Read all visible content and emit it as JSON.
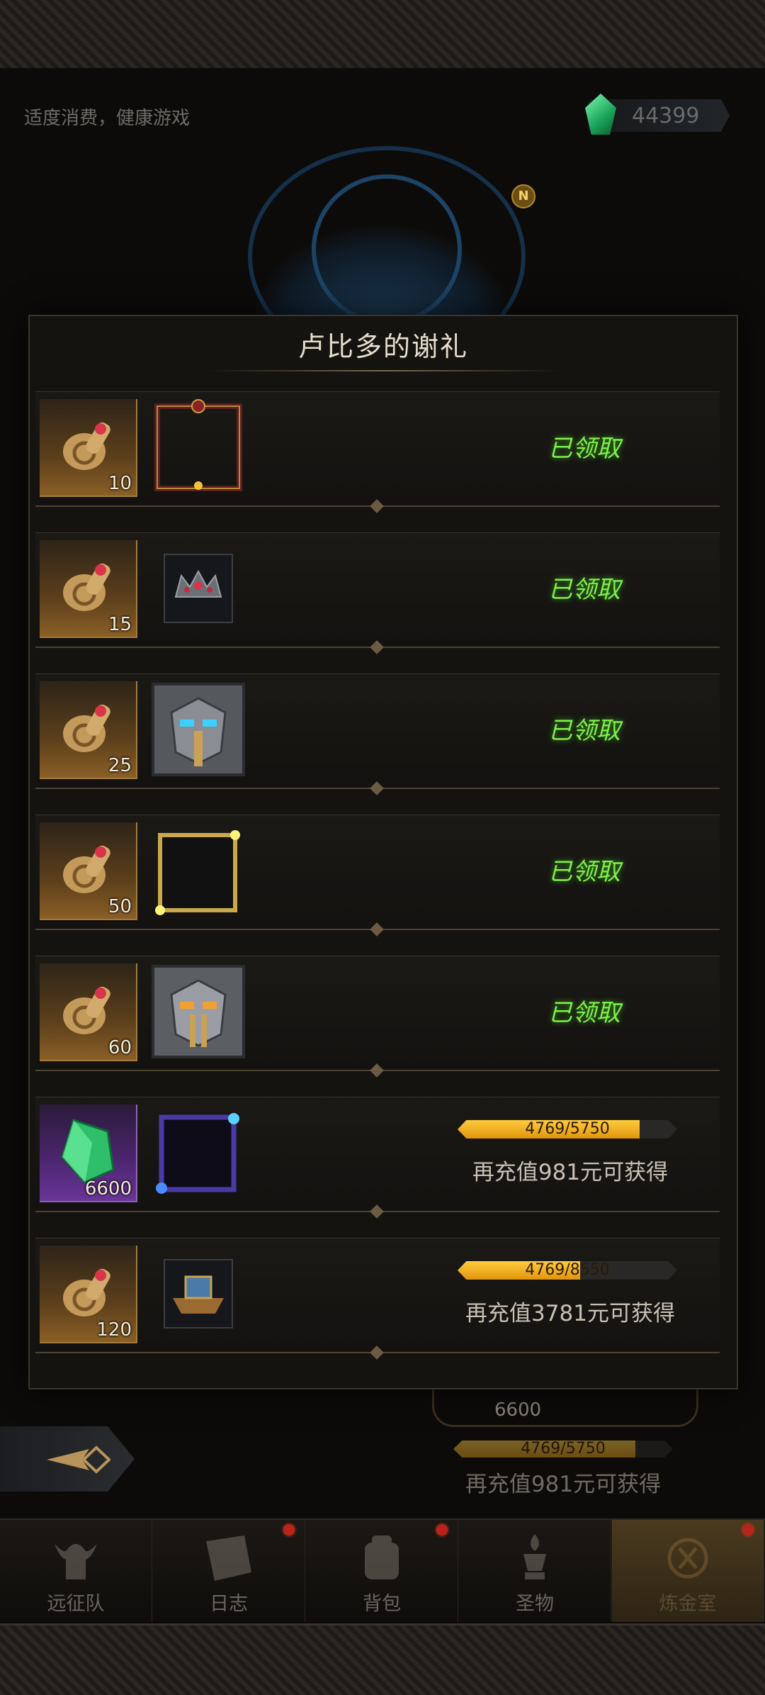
{
  "header": {
    "health_notice": "适度消费，健康游戏",
    "currency_value": "44399",
    "compass_label": "N"
  },
  "modal": {
    "title": "卢比多的谢礼",
    "rows": [
      {
        "item_qty": "10",
        "reward_icon": "frame-icon",
        "status": "已领取"
      },
      {
        "item_qty": "15",
        "reward_icon": "crown-icon",
        "status": "已领取"
      },
      {
        "item_qty": "25",
        "reward_icon": "helmet-icon",
        "status": "已领取"
      },
      {
        "item_qty": "50",
        "reward_icon": "frame-icon",
        "status": "已领取"
      },
      {
        "item_qty": "60",
        "reward_icon": "helmet-icon",
        "status": "已领取"
      },
      {
        "item_qty": "6600",
        "reward_icon": "frame-icon",
        "progress_text": "4769/5750",
        "progress": 0.829,
        "hint": "再充值981元可获得"
      },
      {
        "item_qty": "120",
        "reward_icon": "ship-icon",
        "progress_text": "4769/8550",
        "progress": 0.558,
        "hint": "再充值3781元可获得"
      }
    ]
  },
  "background": {
    "qty": "6600",
    "progress_text": "4769/5750",
    "progress": 0.829,
    "hint": "再充值981元可获得"
  },
  "nav": {
    "items": [
      {
        "label": "远征队",
        "icon": "viking-helmet-icon",
        "dot": false
      },
      {
        "label": "日志",
        "icon": "journal-icon",
        "dot": true
      },
      {
        "label": "背包",
        "icon": "backpack-icon",
        "dot": true
      },
      {
        "label": "圣物",
        "icon": "relic-icon",
        "dot": false
      },
      {
        "label": "炼金室",
        "icon": "alchemy-icon",
        "dot": true
      }
    ]
  },
  "colors": {
    "status_green": "#7ef04a",
    "progress_gold": "#f0aa1c",
    "notify_red": "#b8231a"
  }
}
